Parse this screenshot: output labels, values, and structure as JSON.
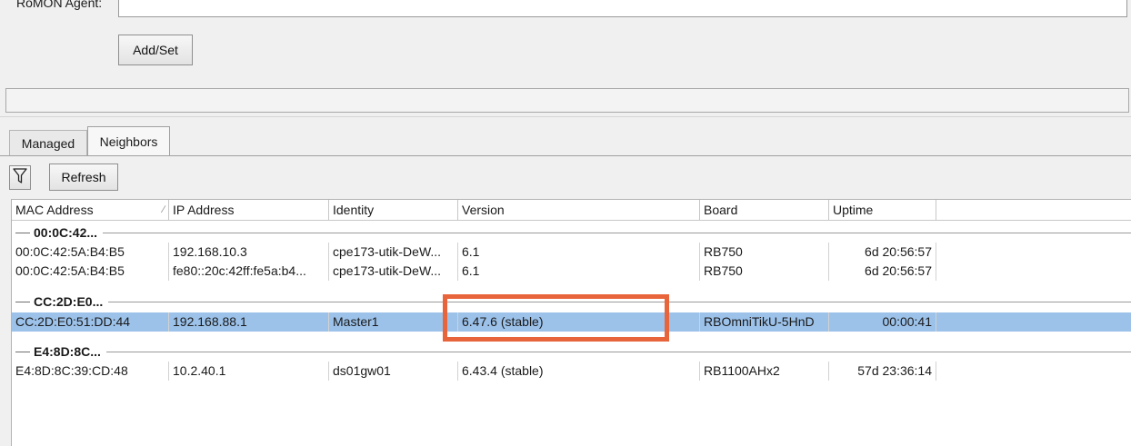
{
  "romon": {
    "agent_label": "RoMON Agent:",
    "agent_value": "",
    "add_set_label": "Add/Set"
  },
  "tabs": [
    {
      "label": "Managed"
    },
    {
      "label": "Neighbors"
    }
  ],
  "toolbar": {
    "filter_icon": "funnel-icon",
    "refresh_label": "Refresh"
  },
  "table": {
    "columns": [
      "MAC Address",
      "IP Address",
      "Identity",
      "Version",
      "Board",
      "Uptime"
    ],
    "groups": [
      {
        "label": "00:0C:42...",
        "rows": [
          [
            "00:0C:42:5A:B4:B5",
            "192.168.10.3",
            "cpe173-utik-DeW...",
            "6.1",
            "RB750",
            "6d 20:56:57"
          ],
          [
            "00:0C:42:5A:B4:B5",
            "fe80::20c:42ff:fe5a:b4...",
            "cpe173-utik-DeW...",
            "6.1",
            "RB750",
            "6d 20:56:57"
          ]
        ]
      },
      {
        "label": "CC:2D:E0...",
        "rows": [
          [
            "CC:2D:E0:51:DD:44",
            "192.168.88.1",
            "Master1",
            "6.47.6 (stable)",
            "RBOmniTikU-5HnD",
            "00:00:41"
          ]
        ]
      },
      {
        "label": "E4:8D:8C...",
        "rows": [
          [
            "E4:8D:8C:39:CD:48",
            "10.2.40.1",
            "ds01gw01",
            "6.43.4 (stable)",
            "RB1100AHx2",
            "57d 23:36:14"
          ]
        ]
      }
    ]
  },
  "colors": {
    "selected_row": "#9cc2ea",
    "highlight_box": "#e8643b"
  }
}
